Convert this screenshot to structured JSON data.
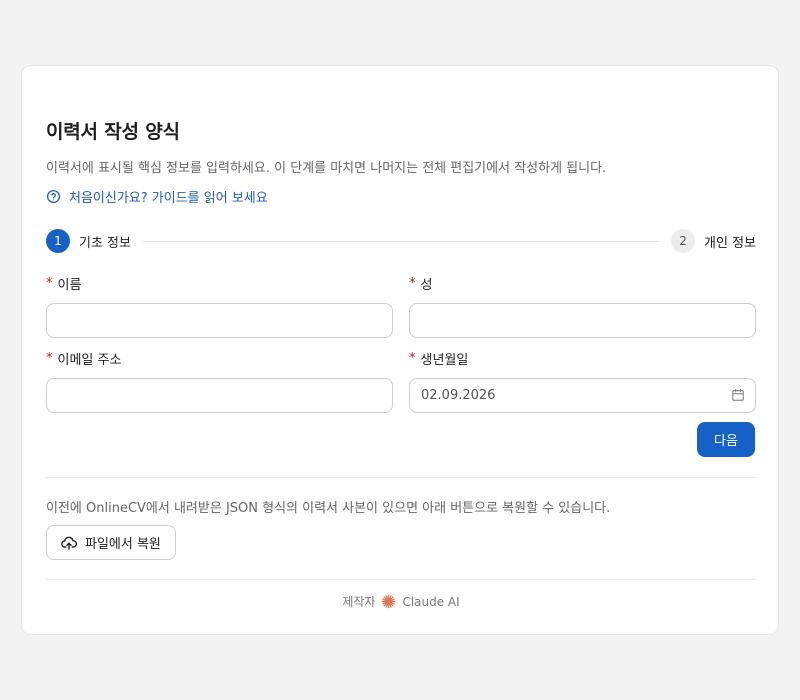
{
  "form": {
    "title": "이력서 작성 양식",
    "subtitle": "이력서에 표시될 핵심 정보를 입력하세요. 이 단계를 마치면 나머지는 전체 편집기에서 작성하게 됩니다.",
    "guide_link": "처음이신가요? 가이드를 읽어 보세요"
  },
  "stepper": {
    "steps": [
      {
        "number": "1",
        "label": "기초 정보"
      },
      {
        "number": "2",
        "label": "개인 정보"
      }
    ]
  },
  "fields": {
    "first_name": {
      "label": "이름",
      "value": "",
      "placeholder": ""
    },
    "last_name": {
      "label": "성",
      "value": "",
      "placeholder": ""
    },
    "email": {
      "label": "이메일 주소",
      "value": "",
      "placeholder": ""
    },
    "birthdate": {
      "label": "생년월일",
      "value": "02.09.2026",
      "placeholder": ""
    }
  },
  "required_marker": "*",
  "actions": {
    "next_label": "다음"
  },
  "restore": {
    "note": "이전에 OnlineCV에서 내려받은 JSON 형식의 이력서 사본이 있으면 아래 버튼으로 복원할 수 있습니다.",
    "button_label": "파일에서 복원"
  },
  "footer": {
    "made_by": "제작자",
    "brand": "Claude AI"
  },
  "colors": {
    "accent": "#1661c7",
    "link": "#1f5fb8",
    "required": "#c0202a",
    "brand_mark": "#d97757"
  }
}
